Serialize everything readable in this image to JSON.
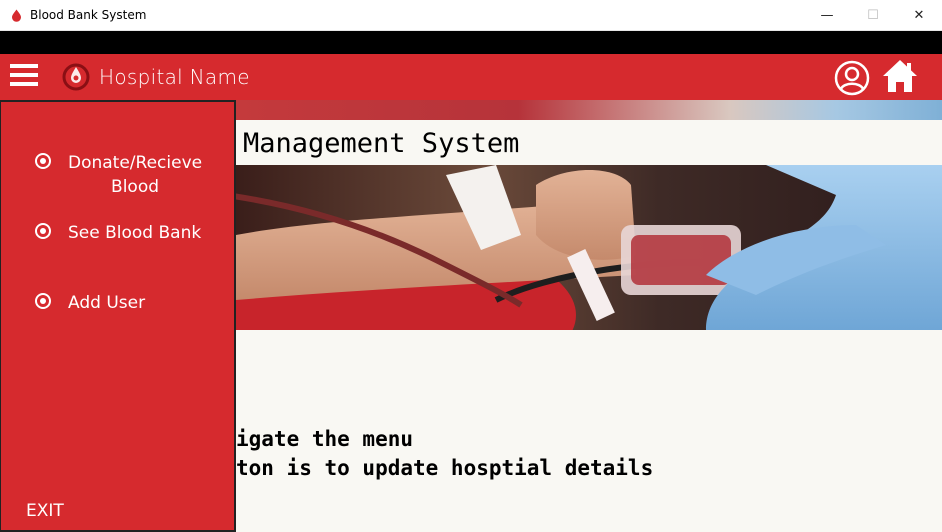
{
  "window": {
    "title": "Blood Bank System",
    "controls": {
      "minimize": "—",
      "maximize": "☐",
      "close": "✕"
    }
  },
  "header": {
    "hospital_name": "Hospital Name",
    "icons": [
      "menu-icon",
      "blood-drop-logo-icon",
      "user-profile-icon",
      "home-icon"
    ]
  },
  "sidebar": {
    "items": [
      {
        "label_line1": "Donate/Recieve",
        "label_line2": "Blood"
      },
      {
        "label_line1": "See Blood Bank",
        "label_line2": ""
      },
      {
        "label_line1": "Add User",
        "label_line2": ""
      }
    ],
    "exit_label": "EXIT"
  },
  "main": {
    "title": "Management System",
    "instructions": [
      "igate the menu",
      "ton is to update hosptial details"
    ]
  },
  "colors": {
    "brand_red": "#d62a2e",
    "background": "#f9f8f3"
  }
}
